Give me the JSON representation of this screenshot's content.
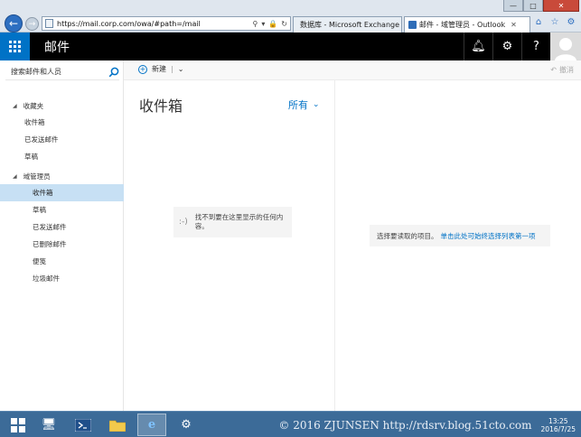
{
  "browser": {
    "url": "https://mail.corp.com/owa/#path=/mail",
    "tabs": [
      {
        "label": "数据库 - Microsoft Exchange",
        "active": false
      },
      {
        "label": "邮件 - 域管理员 - Outlook",
        "active": true
      }
    ],
    "window_controls": {
      "minimize": "—",
      "maximize": "□",
      "close": "✕"
    }
  },
  "header": {
    "app_title": "邮件"
  },
  "search": {
    "placeholder": "搜索邮件和人员"
  },
  "folders": {
    "favorites": {
      "label": "收藏夹",
      "items": [
        "收件箱",
        "已发送邮件",
        "草稿"
      ]
    },
    "mailbox": {
      "label": "域管理员",
      "items": [
        "收件箱",
        "草稿",
        "已发送邮件",
        "已删除邮件",
        "便笺",
        "垃圾邮件"
      ],
      "selected_index": 0
    }
  },
  "toolbar": {
    "new_label": "新建",
    "undo_label": "撤消"
  },
  "message_list": {
    "title": "收件箱",
    "filter_label": "所有",
    "empty_face": ":-)",
    "empty_text": "找不到要在这里显示的任何内容。"
  },
  "reading_pane": {
    "prompt": "选择要读取的项目。",
    "link": "单击此处可始终选择列表第一项"
  },
  "taskbar": {
    "watermark": "© 2016 ZJUNSEN http://rdsrv.blog.51cto.com",
    "time": "13:25",
    "date": "2016/7/25"
  },
  "colors": {
    "accent": "#0072c6",
    "header_bg": "#000000",
    "selection": "#c7e0f4",
    "taskbar": "#3c6b98"
  }
}
